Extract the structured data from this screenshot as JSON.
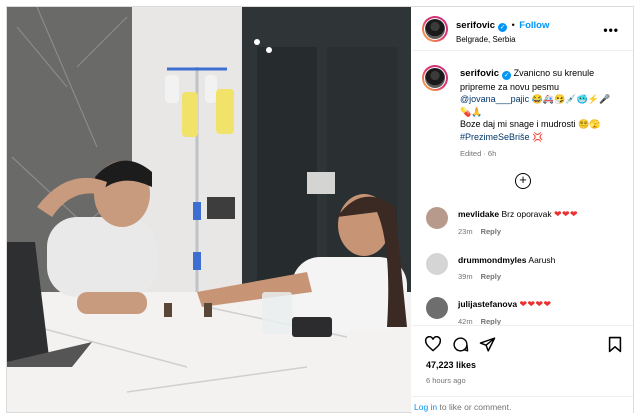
{
  "post": {
    "username": "serifovic",
    "verified_mark": "✓",
    "follow_label": "Follow",
    "location": "Belgrade, Serbia",
    "more_label": "•••",
    "media_description": "",
    "caption": {
      "username": "serifovic",
      "line1": "Zvanicno su krenule pripreme za novu pesmu",
      "mention": "@jovana___pajic",
      "emoji1": "😂🚑🤧💉🥶⚡🎤",
      "emoji2": "💊🙏",
      "line2": "Boze daj mi snage i mudrosti",
      "emoji3": "😵‍💫🫣",
      "hashtag": "#PrezimeSeBriše",
      "emoji4": "💢",
      "meta": "Edited · 6h"
    },
    "load_more_icon": "plus-circle-icon"
  },
  "comments": [
    {
      "user": "mevlidake",
      "text": "Brz oporavak",
      "hearts": "❤❤❤",
      "time": "23m",
      "reply": "Reply",
      "avatar_color": "#b79a8c"
    },
    {
      "user": "drummondmyles",
      "text": "Aarush",
      "hearts": "",
      "time": "39m",
      "reply": "Reply",
      "avatar_color": "#d5d5d5"
    },
    {
      "user": "julijastefanova",
      "text": "",
      "hearts": "❤❤❤❤",
      "time": "42m",
      "reply": "Reply",
      "avatar_color": "#6e6e6e"
    }
  ],
  "actions": {
    "like_icon": "heart-icon",
    "comment_icon": "comment-icon",
    "share_icon": "share-icon",
    "save_icon": "bookmark-icon",
    "likes": "47,223 likes",
    "time_ago": "6 hours ago",
    "login_link": "Log in",
    "login_text": "to like or comment."
  },
  "colors": {
    "accent": "#0095f6",
    "heart": "#ed2f2f",
    "muted": "#737373"
  }
}
